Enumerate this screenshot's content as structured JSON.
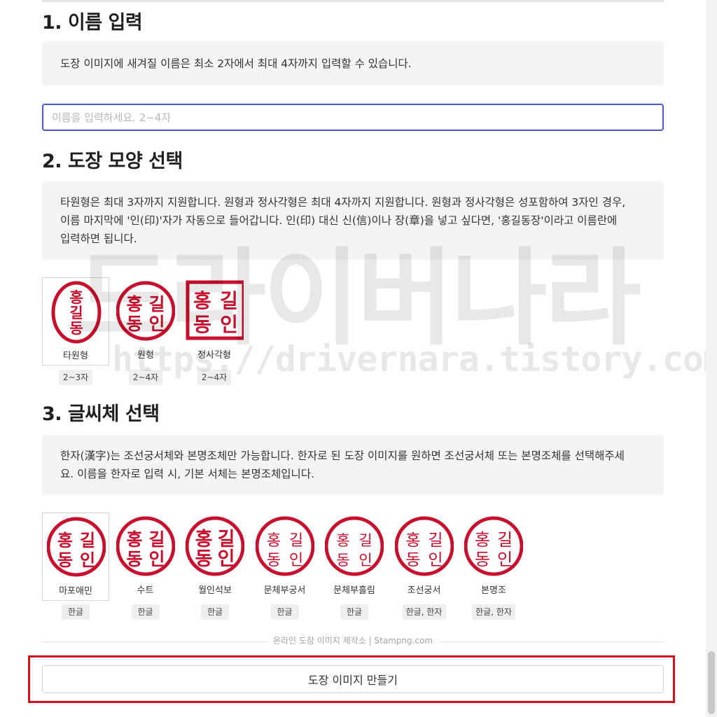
{
  "section1": {
    "heading": "1. 이름 입력",
    "note": "도장 이미지에 새겨질 이름은 최소 2자에서 최대 4자까지 입력할 수 있습니다.",
    "input_placeholder": "이름을 입력하세요. 2~4자",
    "input_value": ""
  },
  "section2": {
    "heading": "2. 도장 모양 선택",
    "note_line1": "타원형은 최대 3자까지 지원합니다. 원형과 정사각형은 최대 4자까지 지원합니다. 원형과 정사각형은 성포함하여 3자인 경우,",
    "note_line2": "이름 마지막에 '인(印)'자가 자동으로 들어갑니다. 인(印) 대신 신(信)이나 장(章)을 넣고 싶다면, '홍길동장'이라고 이름란에",
    "note_line3": "입력하면 됩니다.",
    "shapes": [
      {
        "label": "타원형",
        "tag": "2~3자",
        "glyphs": [
          "홍",
          "길",
          "동"
        ]
      },
      {
        "label": "원형",
        "tag": "2~4자",
        "glyphs": [
          "홍",
          "동",
          "길",
          "인"
        ]
      },
      {
        "label": "정사각형",
        "tag": "2~4자",
        "glyphs": [
          "홍",
          "동",
          "길",
          "인"
        ]
      }
    ],
    "selected": "타원형"
  },
  "section3": {
    "heading": "3. 글씨체 선택",
    "note_line1": "한자(漢字)는 조선궁서체와 본명조체만 가능합니다. 한자로 된 도장 이미지를 원하면 조선궁서체 또는 본명조체를 선택해주세",
    "note_line2": "요. 이름을 한자로 입력 시, 기본 서체는 본명조체입니다.",
    "fonts": [
      {
        "label": "마포애민",
        "tag": "한글",
        "glyphs": [
          "홍",
          "동",
          "길",
          "인"
        ]
      },
      {
        "label": "수트",
        "tag": "한글",
        "glyphs": [
          "홍",
          "동",
          "길",
          "인"
        ]
      },
      {
        "label": "월인석보",
        "tag": "한글",
        "glyphs": [
          "홍",
          "동",
          "길",
          "인"
        ]
      },
      {
        "label": "문체부궁서",
        "tag": "한글",
        "glyphs": [
          "홍",
          "동",
          "길",
          "인"
        ]
      },
      {
        "label": "문체부흘림",
        "tag": "한글",
        "glyphs": [
          "홍",
          "동",
          "길",
          "인"
        ]
      },
      {
        "label": "조선궁서",
        "tag": "한글, 한자",
        "glyphs": [
          "홍",
          "동",
          "길",
          "인"
        ]
      },
      {
        "label": "본명조",
        "tag": "한글, 한자",
        "glyphs": [
          "홍",
          "동",
          "길",
          "인"
        ]
      }
    ],
    "selected": "마포애민"
  },
  "footer": {
    "text": "온라인 도장 이미지 제작소 | Stampng.com",
    "button_label": "도장 이미지 만들기"
  },
  "watermark": {
    "title": "드라이버나라",
    "url": "https://drivernara.tistory.com"
  },
  "colors": {
    "stamp_red": "#c8102e",
    "input_border": "#4a58c8",
    "highlight_red": "#d4121b"
  }
}
